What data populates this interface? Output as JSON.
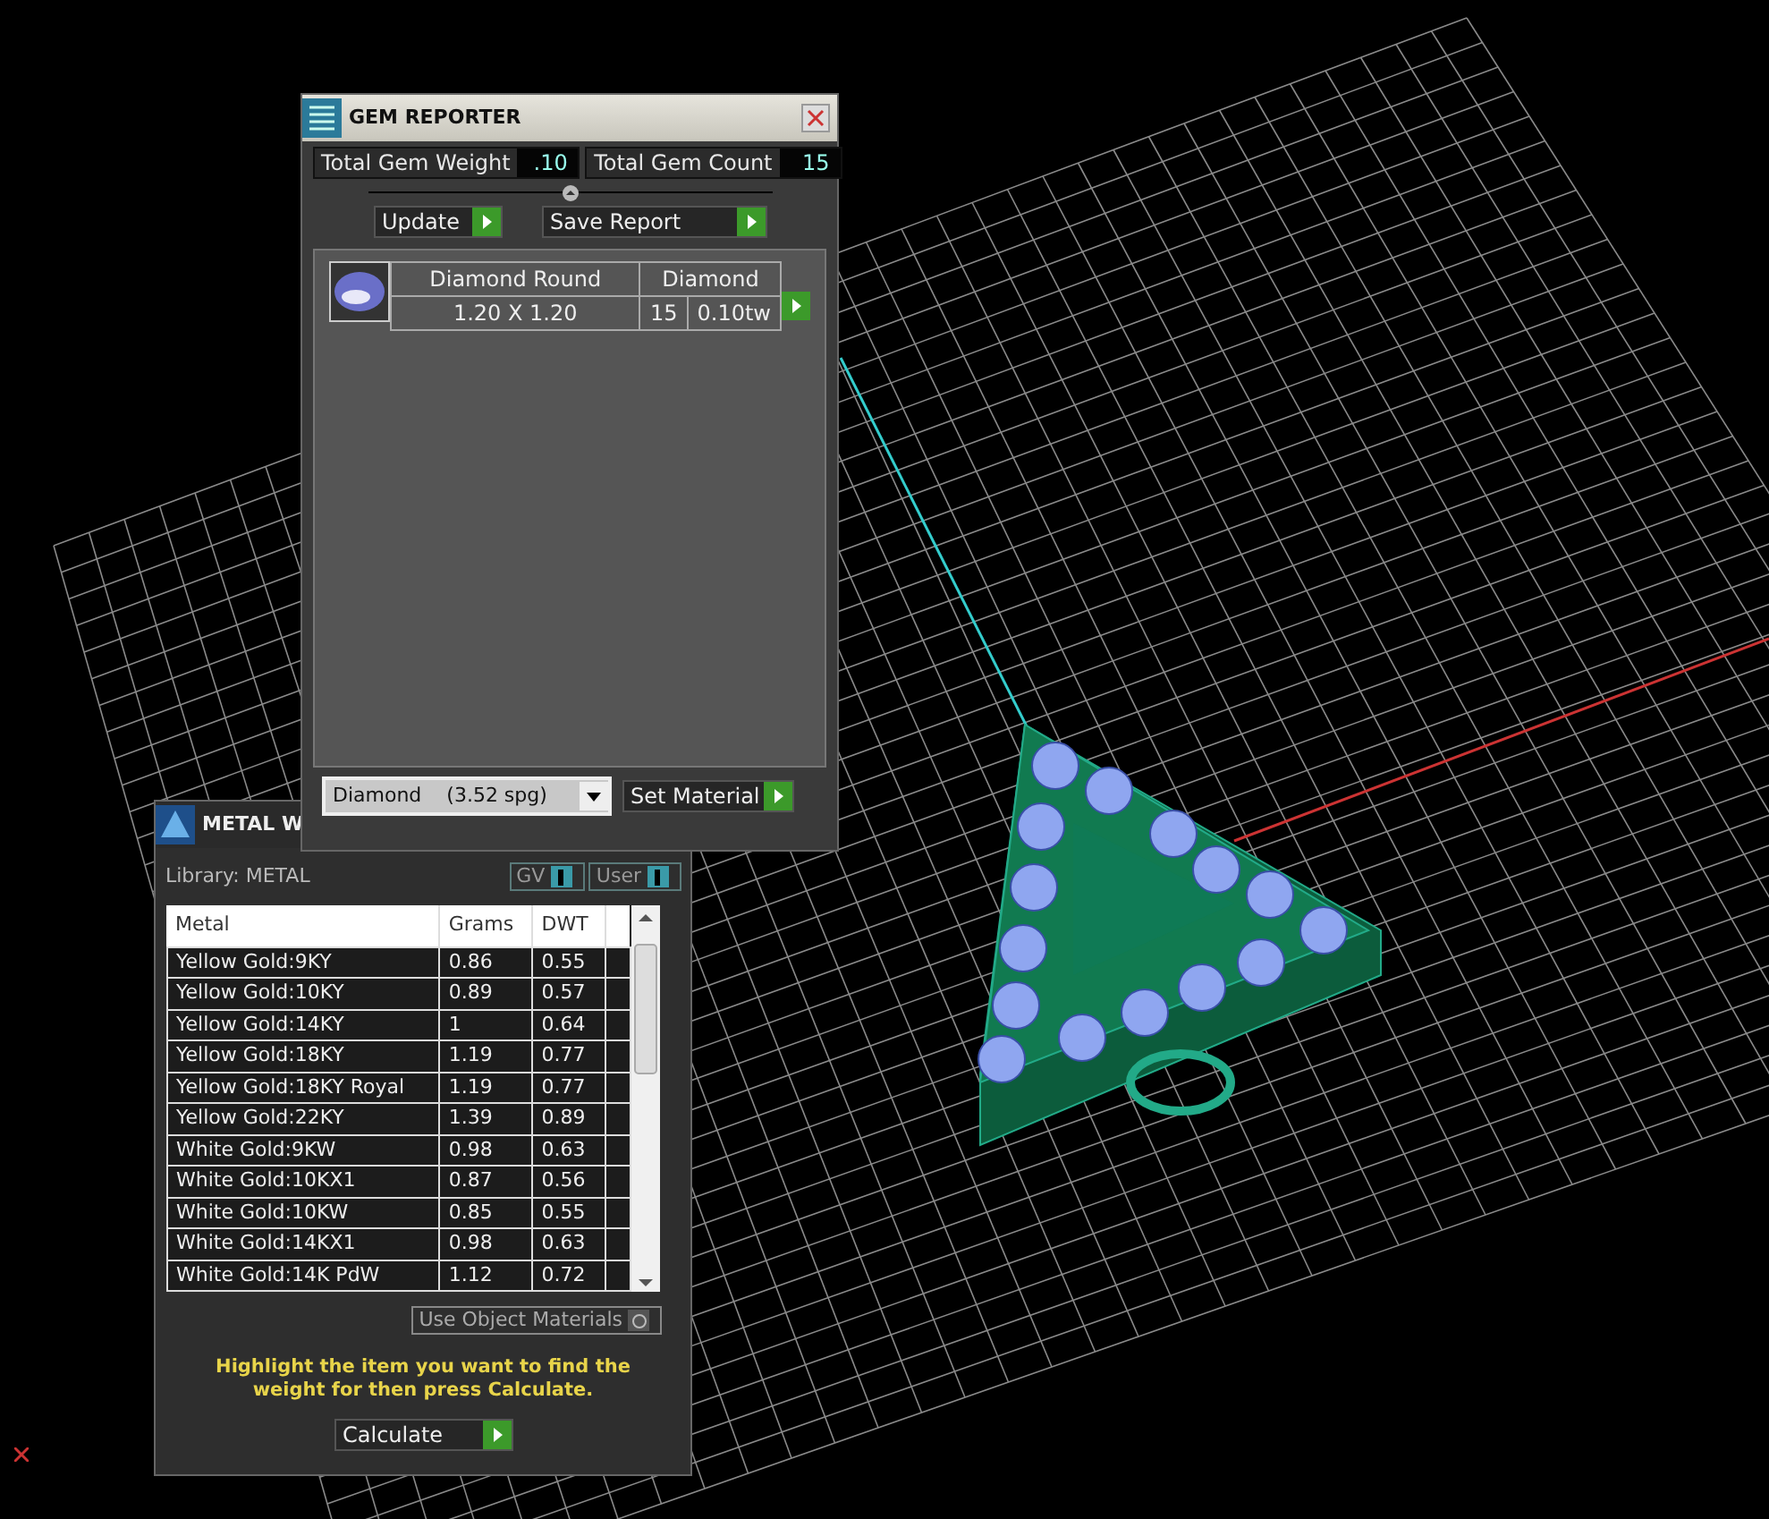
{
  "gem_reporter": {
    "title": "GEM REPORTER",
    "total_gem_weight": {
      "label": "Total Gem Weight",
      "value": ".10"
    },
    "total_gem_count": {
      "label": "Total Gem Count",
      "value": "15"
    },
    "buttons": [
      "Update",
      "Save Report"
    ],
    "gems": [
      {
        "shape": "Diamond Round",
        "material": "Diamond",
        "size": "1.20 X 1.20",
        "count": "15",
        "weight": "0.10tw"
      }
    ],
    "material_select": {
      "value": "Diamond    (3.52 spg)"
    },
    "set_material_button": "Set Material"
  },
  "metal_window": {
    "title": "METAL W",
    "library": "Library: METAL",
    "toggles": [
      {
        "label": "GV",
        "on": true
      },
      {
        "label": "User",
        "on": true
      }
    ],
    "table": {
      "columns": [
        "Metal",
        "Grams",
        "DWT"
      ],
      "rows": [
        [
          "Yellow Gold:9KY",
          "0.86",
          "0.55"
        ],
        [
          "Yellow Gold:10KY",
          "0.89",
          "0.57"
        ],
        [
          "Yellow Gold:14KY",
          "1",
          "0.64"
        ],
        [
          "Yellow Gold:18KY",
          "1.19",
          "0.77"
        ],
        [
          "Yellow Gold:18KY Royal",
          "1.19",
          "0.77"
        ],
        [
          "Yellow Gold:22KY",
          "1.39",
          "0.89"
        ],
        [
          "White Gold:9KW",
          "0.98",
          "0.63"
        ],
        [
          "White Gold:10KX1",
          "0.87",
          "0.56"
        ],
        [
          "White Gold:10KW",
          "0.85",
          "0.55"
        ],
        [
          "White Gold:14KX1",
          "0.98",
          "0.63"
        ],
        [
          "White Gold:14K PdW",
          "1.12",
          "0.72"
        ]
      ]
    },
    "use_object_materials": {
      "label": "Use Object Materials",
      "on": false
    },
    "hint": "Highlight the item you want to find the weight for then press Calculate.",
    "calculate_button": "Calculate"
  }
}
